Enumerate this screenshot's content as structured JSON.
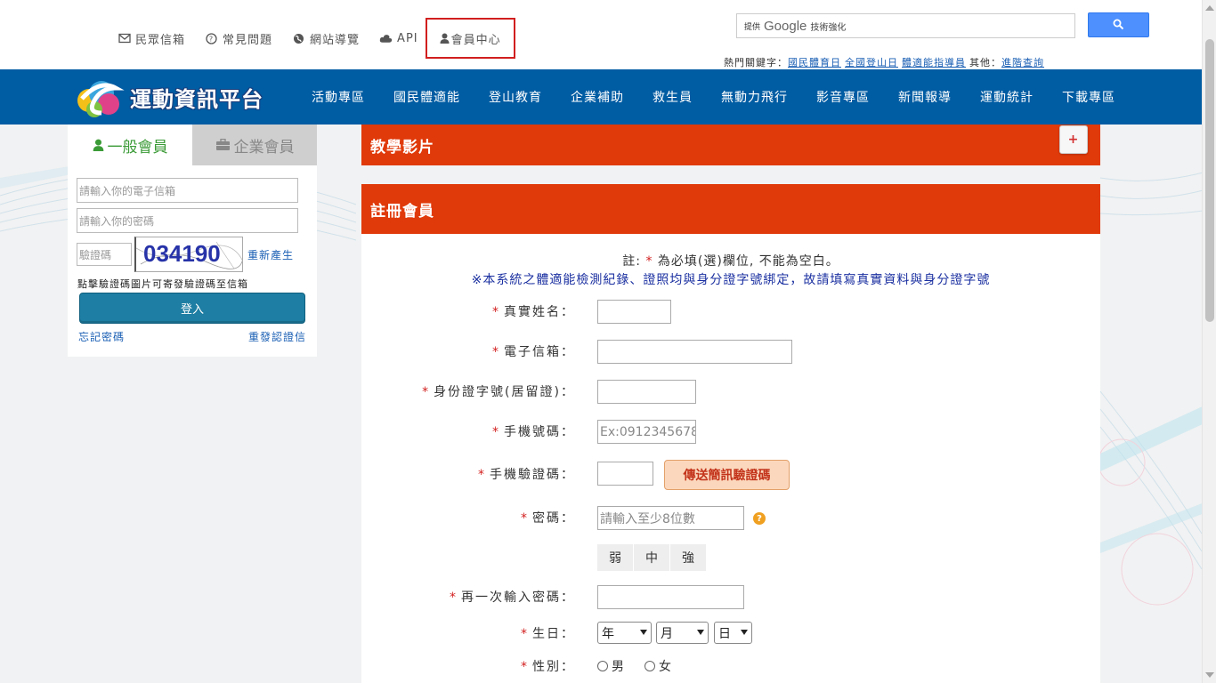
{
  "top_links": [
    {
      "label": "民眾信箱",
      "icon": "mail-icon"
    },
    {
      "label": "常見問題",
      "icon": "question-icon"
    },
    {
      "label": "網站導覽",
      "icon": "globe-icon"
    },
    {
      "label": "API",
      "icon": "cloud-icon"
    },
    {
      "label": "會員中心",
      "icon": "user-icon"
    }
  ],
  "search": {
    "prefix": "提供",
    "brand": "Google",
    "suffix": "技術強化"
  },
  "hotkeys": {
    "label": "熱門關鍵字：",
    "items": [
      "國民體育日",
      "全國登山日",
      "體適能指導員"
    ],
    "other_label": "其他：",
    "other_link": "進階查詢"
  },
  "brand": {
    "logo_text": "運動資訊平台"
  },
  "nav": [
    "活動專區",
    "國民體適能",
    "登山教育",
    "企業補助",
    "救生員",
    "無動力飛行",
    "影音專區",
    "新聞報導",
    "運動統計",
    "下載專區"
  ],
  "login": {
    "tab_general": "一般會員",
    "tab_enterprise": "企業會員",
    "email_placeholder": "請輸入你的電子信箱",
    "password_placeholder": "請輸入你的密碼",
    "captcha_placeholder": "驗證碼",
    "captcha_code": "034190",
    "regenerate": "重新產生",
    "hint": "點擊驗證碼圖片可寄發驗證碼至信箱",
    "login_button": "登入",
    "forgot": "忘記密碼",
    "resend": "重發認證信"
  },
  "video_panel": {
    "title": "教學影片",
    "expand": "+"
  },
  "register": {
    "title": "註冊會員",
    "note_prefix": "註:",
    "note_star": "*",
    "note_suffix": "為必填(選)欄位, 不能為空白。",
    "notice": "※本系統之體適能檢測紀錄、證照均與身分證字號綁定，故請填寫真實資料與身分證字號",
    "fields": {
      "name": "真實姓名：",
      "email": "電子信箱：",
      "id": "身份證字號(居留證)：",
      "phone": "手機號碼：",
      "phone_placeholder": "Ex:0912345678",
      "sms_code": "手機驗證碼：",
      "sms_button": "傳送簡訊驗證碼",
      "password": "密碼：",
      "password_placeholder": "請輸入至少8位數",
      "strength": [
        "弱",
        "中",
        "強"
      ],
      "password_confirm": "再一次輸入密碼：",
      "birthday": "生日：",
      "year": "年",
      "month": "月",
      "day": "日",
      "gender": "性別：",
      "male": "男",
      "female": "女"
    },
    "required_mark": "*"
  },
  "colors": {
    "nav_bg": "#005ca3",
    "panel_head": "#e03a0a",
    "login_button": "#1e7ea3",
    "member_highlight": "#d21f1f"
  }
}
